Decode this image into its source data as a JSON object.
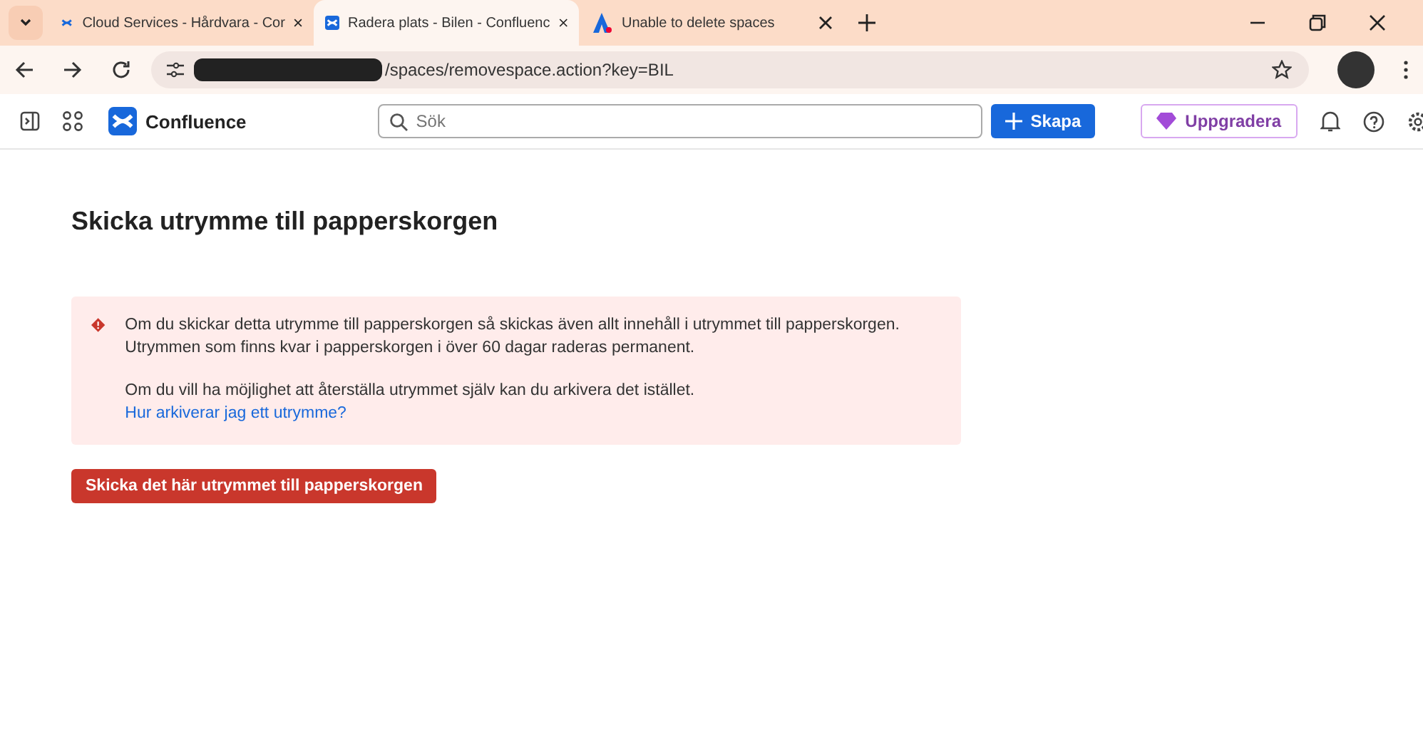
{
  "browser": {
    "tabs": [
      {
        "title": "Cloud Services - Hårdvara - Cor",
        "selected": false
      },
      {
        "title": "Radera plats - Bilen - Confluenc",
        "selected": true
      },
      {
        "title": "Unable to delete spaces",
        "selected": false
      }
    ],
    "address": "/spaces/removespace.action?key=BIL"
  },
  "app": {
    "product": "Confluence",
    "search_placeholder": "Sök",
    "create": "Skapa",
    "upgrade": "Uppgradera"
  },
  "page": {
    "title": "Skicka utrymme till papperskorgen",
    "warning": {
      "paragraphs": [
        "Om du skickar detta utrymme till papperskorgen så skickas även allt innehåll i utrymmet till papperskorgen. Utrymmen som finns kvar i papperskorgen i över 60 dagar raderas permanent.",
        "Om du vill ha möjlighet att återställa utrymmet själv kan du arkivera det istället."
      ],
      "link": "Hur arkiverar jag ett utrymme?"
    },
    "button": "Skicka det här utrymmet till papperskorgen"
  }
}
